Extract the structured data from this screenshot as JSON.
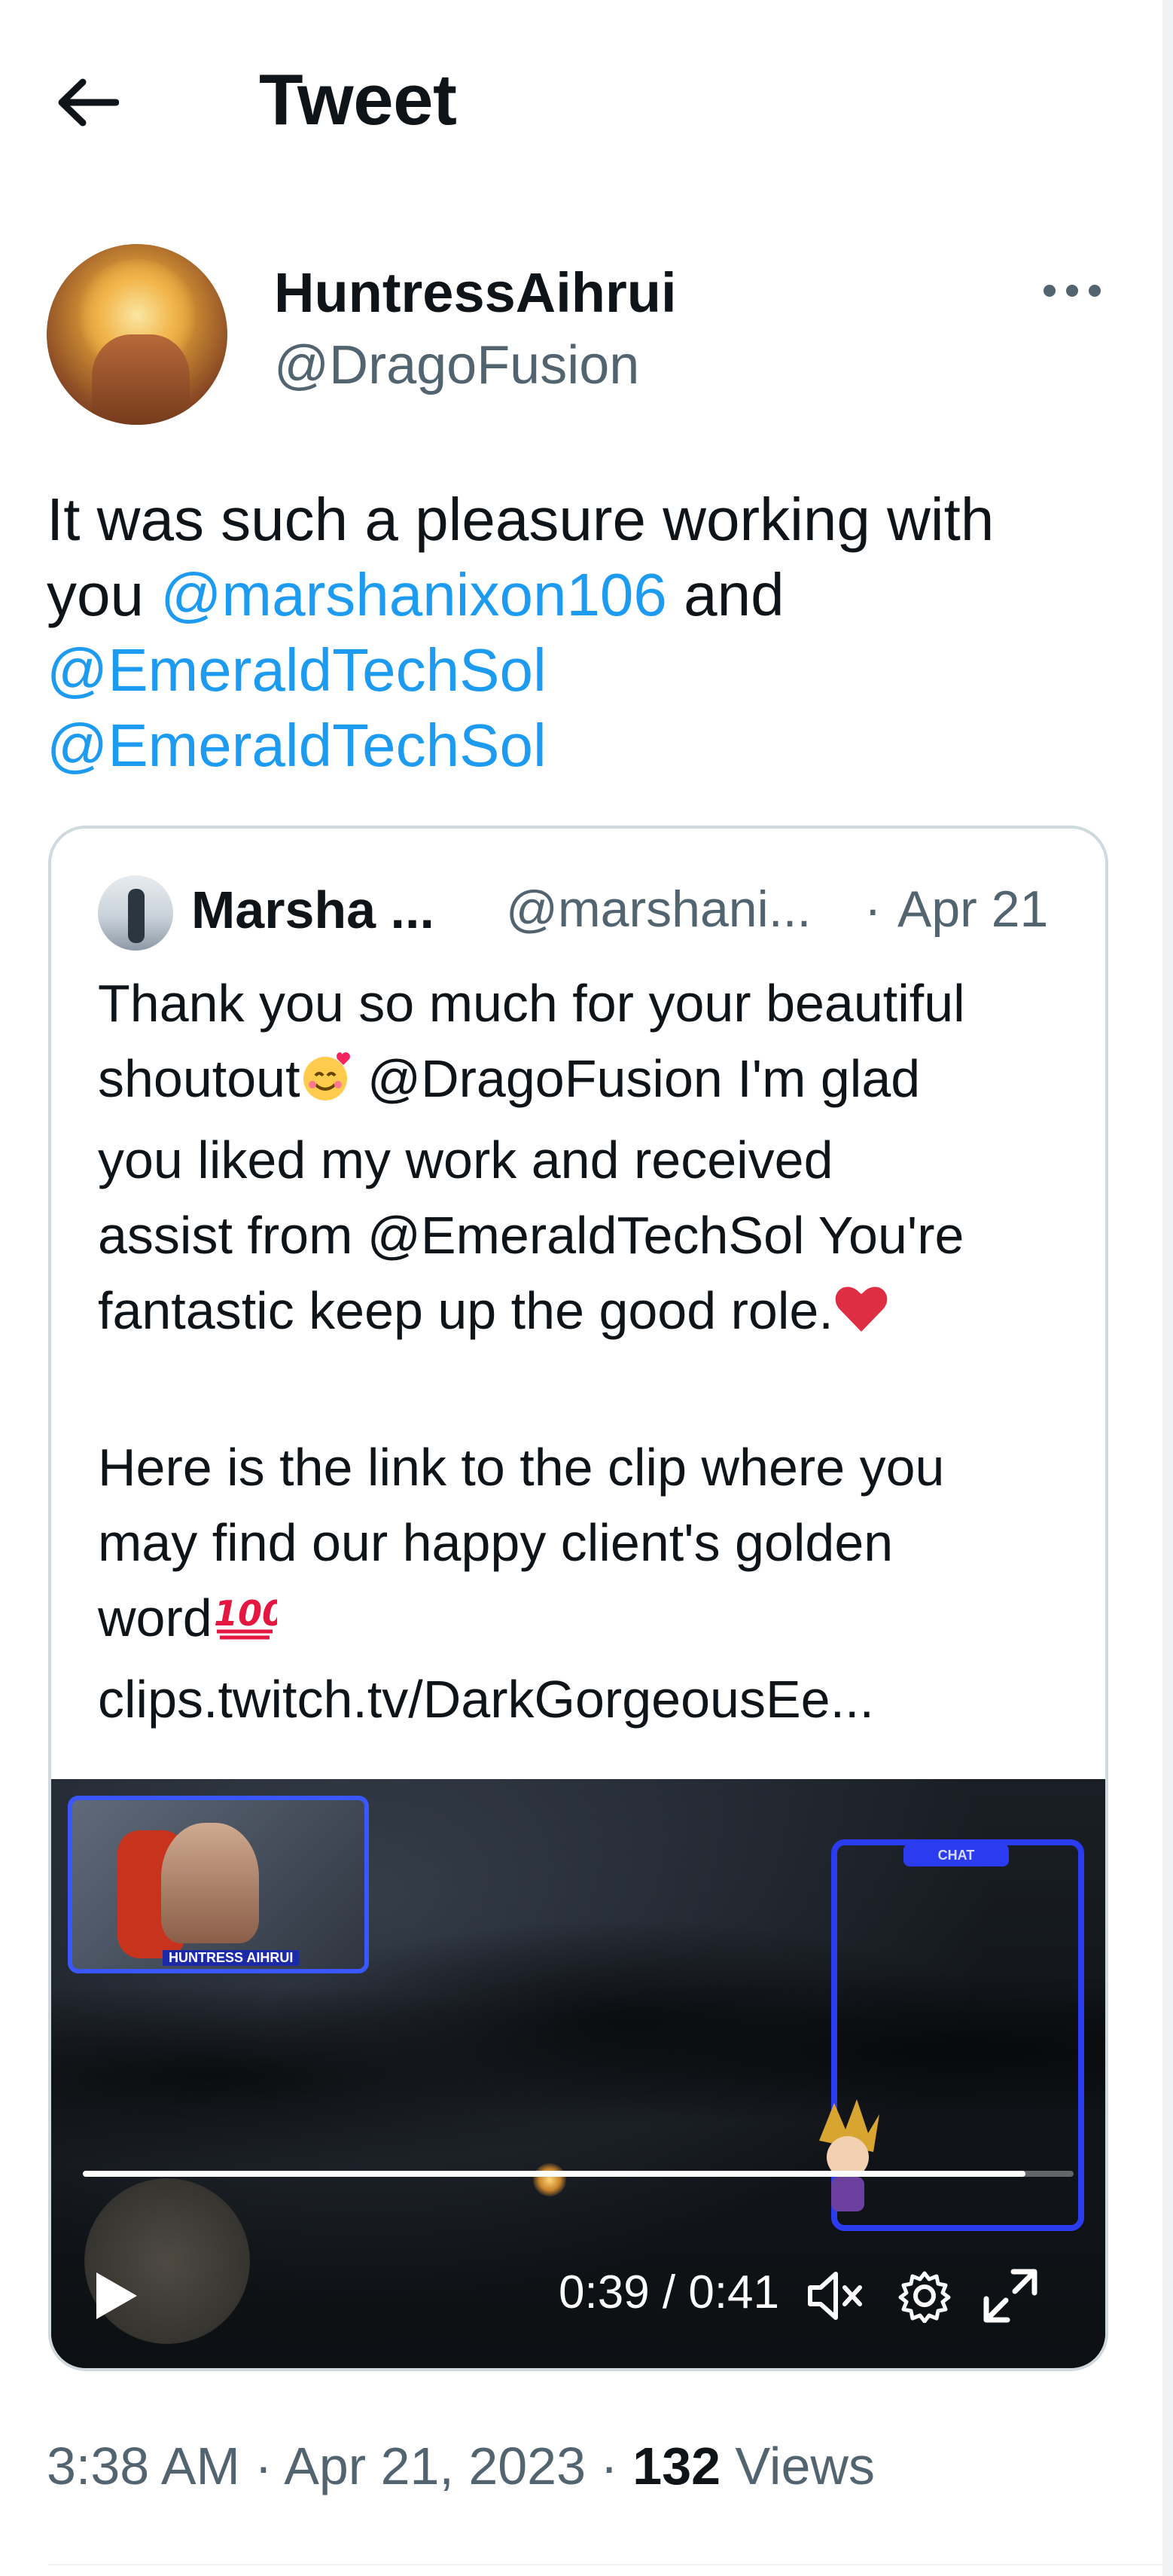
{
  "header": {
    "title": "Tweet",
    "back_icon": "arrow-left-icon"
  },
  "author": {
    "name": "HuntressAihrui",
    "handle": "@DragoFusion",
    "more_icon": "more-horizontal-icon"
  },
  "tweet": {
    "lines": [
      [
        {
          "text": "It was such a pleasure working with",
          "type": "text"
        }
      ],
      [
        {
          "text": "you ",
          "type": "text"
        },
        {
          "text": "@marshanixon106",
          "type": "mention"
        },
        {
          "text": " and",
          "type": "text"
        }
      ],
      [
        {
          "text": "@EmeraldTechSol",
          "type": "mention"
        }
      ],
      [
        {
          "text": "@EmeraldTechSol",
          "type": "mention"
        }
      ]
    ]
  },
  "quote": {
    "name": "Marsha ...",
    "handle": "@marshani...",
    "separator": "·",
    "date": "Apr 21",
    "lines": [
      "Thank you so much for your beautiful",
      "shoutout",
      "you liked my work and received",
      "assist from @EmeraldTechSol You're",
      "fantastic keep up the good role.",
      "",
      "Here is the link to the clip where you",
      "may find our happy client's golden",
      "word",
      "clips.twitch.tv/DarkGorgeousEe..."
    ],
    "line2_suffix": " @DragoFusion I'm glad",
    "emojis": {
      "smile_hearts": "smiling-face-with-hearts-icon",
      "heart": "red-heart-icon",
      "hundred": "hundred-points-icon"
    },
    "video": {
      "current_time": "0:39",
      "duration": "0:41",
      "time_display": "0:39 / 0:41",
      "progress": 0.951,
      "webcam_label": "HUNTRESS AIHRUI",
      "chat_label": "CHAT",
      "controls": [
        "play-icon",
        "mute-icon",
        "settings-icon",
        "fullscreen-icon"
      ]
    }
  },
  "meta": {
    "time": "3:38 AM",
    "sep": " · ",
    "date": "Apr 21, 2023",
    "views_count": "132",
    "views_label": " Views"
  },
  "colors": {
    "accent": "#1d9bf0",
    "muted": "#536471",
    "text": "#0f1419",
    "border": "#cfd9de"
  }
}
